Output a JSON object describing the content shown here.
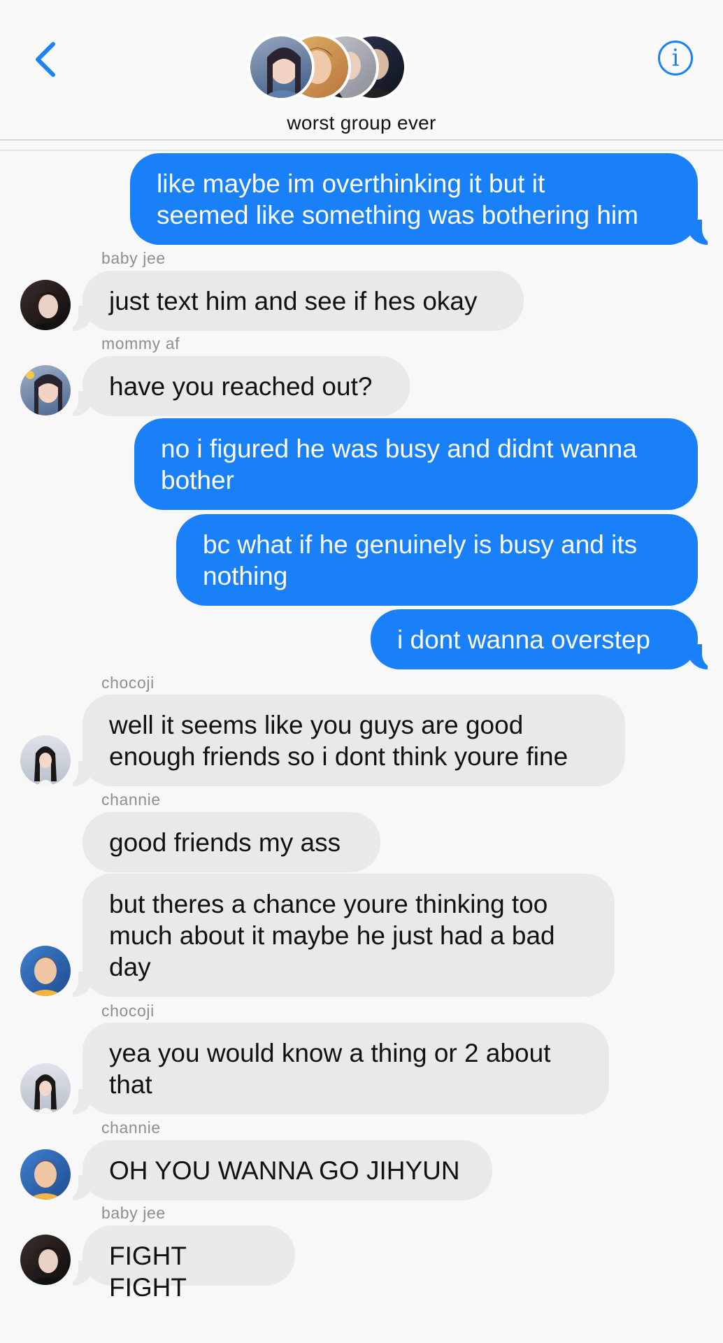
{
  "header": {
    "group_title": "worst group ever",
    "back_icon": "chevron-left-icon",
    "info_icon": "info-icon",
    "info_glyph": "i",
    "accent_color": "#1a82f4"
  },
  "colors": {
    "outgoing_bubble": "#1a80f8",
    "incoming_bubble": "#e9e9ec",
    "background": "#f8f8f9"
  },
  "messages": [
    {
      "direction": "out",
      "text": "like maybe im overthinking it but it\nseemed like something was bothering him"
    },
    {
      "direction": "in",
      "sender": "baby jee",
      "text": "just text him and see if hes okay"
    },
    {
      "direction": "in",
      "sender": "mommy af",
      "text": "have you reached out?"
    },
    {
      "direction": "out",
      "text": "no i figured he was busy and didnt wanna\nbother"
    },
    {
      "direction": "out",
      "text": "bc what if he genuinely is busy and its\nnothing"
    },
    {
      "direction": "out",
      "text": "i dont wanna overstep"
    },
    {
      "direction": "in",
      "sender": "chocoji",
      "text": "well it seems like you guys are good\nenough friends so i dont think youre fine"
    },
    {
      "direction": "in",
      "sender": "channie",
      "text": "good friends my ass"
    },
    {
      "direction": "in",
      "text": "but theres a chance youre thinking too\nmuch about it maybe he just had a bad\nday"
    },
    {
      "direction": "in",
      "sender": "chocoji",
      "text": "yea you would know a thing or 2 about\nthat"
    },
    {
      "direction": "in",
      "sender": "channie",
      "text": "OH YOU WANNA GO JIHYUN"
    },
    {
      "direction": "in",
      "sender": "baby jee",
      "text": "FIGHT FIGHT"
    }
  ]
}
